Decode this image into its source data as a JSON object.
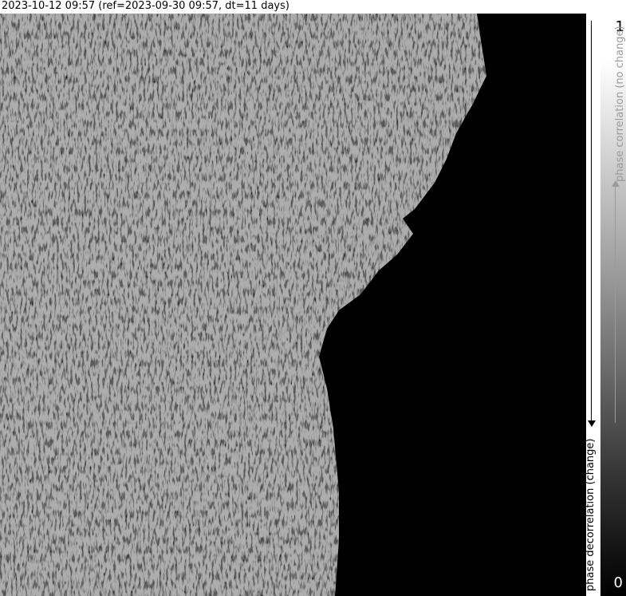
{
  "title": "2023-10-12 09:57 (ref=2023-09-30 09:57, dt=11 days)",
  "colorbar": {
    "max_label": "1",
    "min_label": "0",
    "top_caption": "phase correlation (no change)",
    "bottom_caption": "phase decorrelation (change)"
  }
}
